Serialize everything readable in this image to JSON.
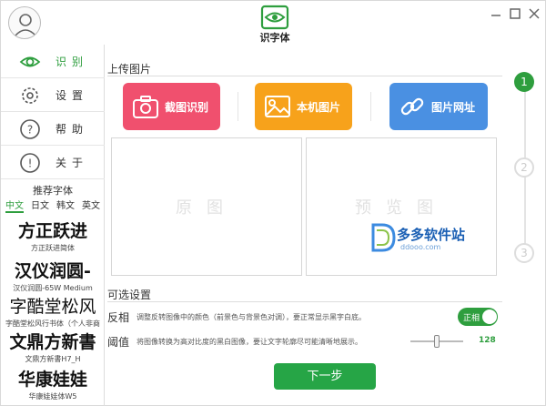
{
  "app": {
    "title": "识字体"
  },
  "sidebar": {
    "items": [
      {
        "label": "识别",
        "icon": "eye-icon",
        "active": true
      },
      {
        "label": "设置",
        "icon": "gear-icon",
        "active": false
      },
      {
        "label": "帮助",
        "icon": "help-icon",
        "active": false
      },
      {
        "label": "关于",
        "icon": "info-icon",
        "active": false
      }
    ],
    "recommended_title": "推荐字体",
    "lang_tabs": [
      "中文",
      "日文",
      "韩文",
      "英文"
    ],
    "fonts": [
      {
        "sample": "方正跃进",
        "name": "方正跃进简体"
      },
      {
        "sample": "汉仪润圆-",
        "name": "汉仪润圆-65W Medium"
      },
      {
        "sample": "字酷堂松风",
        "name": "字酷堂松风行书体（个人非商"
      },
      {
        "sample": "文鼎方新書",
        "name": "文鼎方新書H7_H"
      },
      {
        "sample": "华康娃娃",
        "name": "华康娃娃体W5"
      }
    ]
  },
  "upload": {
    "title": "上传图片",
    "buttons": [
      {
        "label": "截图识别",
        "icon": "camera-icon"
      },
      {
        "label": "本机图片",
        "icon": "image-icon"
      },
      {
        "label": "图片网址",
        "icon": "link-icon"
      }
    ]
  },
  "preview": {
    "original_label": "原图",
    "result_label": "预览图"
  },
  "watermark": {
    "main": "多多软件站",
    "sub": "ddooo.com"
  },
  "options": {
    "title": "可选设置",
    "invert": {
      "label": "反相",
      "desc": "调整反转图像中的颜色（前景色与背景色对调），要正常显示黑字白底。",
      "toggle_text": "正相"
    },
    "threshold": {
      "label": "阈值",
      "desc": "将图像转换为高对比度的黑白图像，要让文字轮廓尽可能清晰地展示。",
      "value": "128",
      "level": 0.5
    }
  },
  "next_button": "下一步",
  "steps": [
    "1",
    "2",
    "3"
  ],
  "colors": {
    "accent": "#2e9e3e",
    "red": "#f0506e",
    "orange": "#f7a21b",
    "blue": "#4a90e2"
  }
}
